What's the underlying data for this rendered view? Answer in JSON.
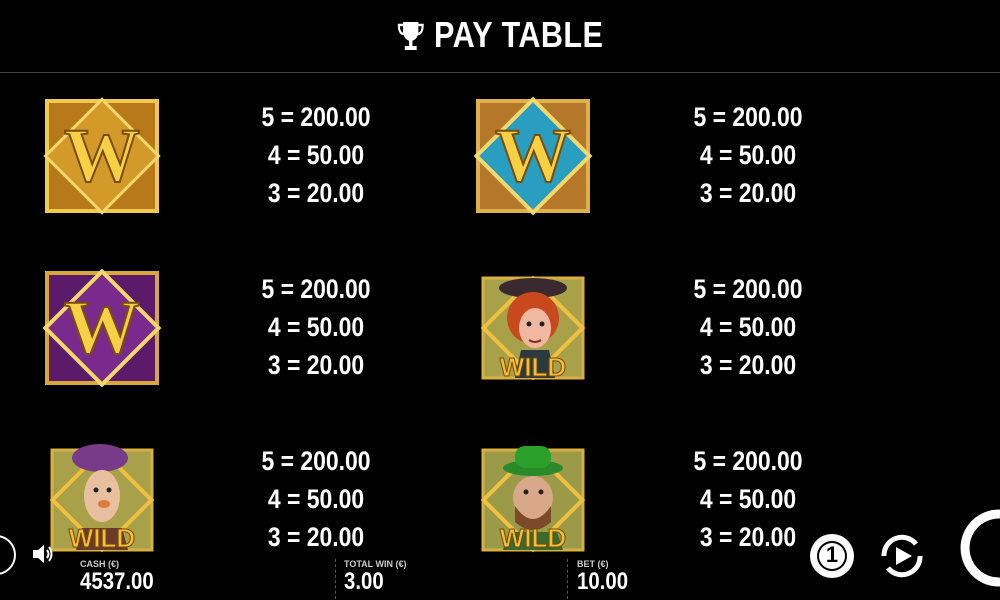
{
  "header": {
    "title": "PAY TABLE",
    "icon": "trophy-icon"
  },
  "symbols": [
    {
      "name": "gold-w",
      "icon": "gold-w-symbol",
      "bg": "#c98a1e",
      "letter": "W",
      "wild": "",
      "pays": [
        "5 = 200.00",
        "4 = 50.00",
        "3 = 20.00"
      ]
    },
    {
      "name": "blue-w",
      "icon": "blue-w-symbol",
      "bg": "#2a8fb0",
      "letter": "W",
      "wild": "",
      "pays": [
        "5 = 200.00",
        "4 = 50.00",
        "3 = 20.00"
      ]
    },
    {
      "name": "purple-w",
      "icon": "purple-w-symbol",
      "bg": "#6a1f7a",
      "letter": "W",
      "wild": "",
      "pays": [
        "5 = 200.00",
        "4 = 50.00",
        "3 = 20.00"
      ]
    },
    {
      "name": "redhead-wild",
      "icon": "redhead-woman-wild-symbol",
      "bg": "#a9a04a",
      "letter": "",
      "wild": "WILD",
      "pays": [
        "5 = 200.00",
        "4 = 50.00",
        "3 = 20.00"
      ]
    },
    {
      "name": "purple-hat-wild",
      "icon": "purple-hat-man-wild-symbol",
      "bg": "#a9a04a",
      "letter": "",
      "wild": "WILD",
      "pays": [
        "5 = 200.00",
        "4 = 50.00",
        "3 = 20.00"
      ]
    },
    {
      "name": "green-hat-wild",
      "icon": "green-hat-man-wild-symbol",
      "bg": "#9b9a48",
      "letter": "",
      "wild": "WILD",
      "pays": [
        "5 = 200.00",
        "4 = 50.00",
        "3 = 20.00"
      ]
    }
  ],
  "footer": {
    "cash_label": "CASH (€)",
    "cash_value": "4537.00",
    "win_label": "TOTAL WIN (€)",
    "win_value": "3.00",
    "bet_label": "BET (€)",
    "bet_value": "10.00"
  },
  "controls": {
    "sound": "speaker-icon",
    "coin_value": "1",
    "autoplay": "autoplay-icon",
    "spin": "spin-icon"
  }
}
